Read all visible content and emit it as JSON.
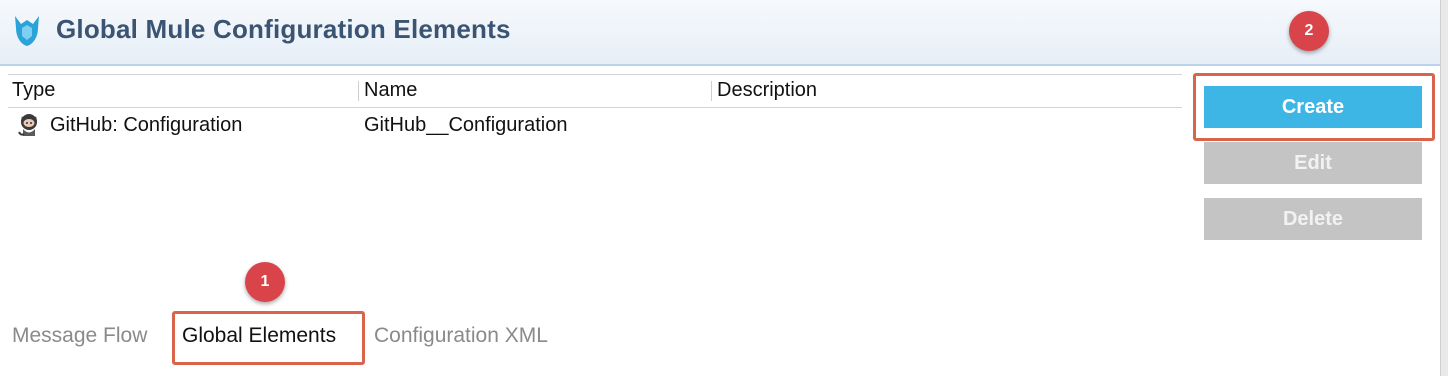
{
  "header": {
    "title": "Global Mule Configuration Elements",
    "logo_icon": "mule-icon"
  },
  "table": {
    "columns": [
      "Type",
      "Name",
      "Description"
    ],
    "rows": [
      {
        "icon": "github-octocat-icon",
        "type": "GitHub: Configuration",
        "name": "GitHub__Configuration",
        "description": ""
      }
    ]
  },
  "buttons": {
    "create": "Create",
    "edit": "Edit",
    "delete": "Delete"
  },
  "tabs": [
    "Message Flow",
    "Global Elements",
    "Configuration XML"
  ],
  "annotations": {
    "badge_1": "1",
    "badge_2": "2"
  },
  "colors": {
    "accent": "#3db6e6",
    "disabled": "#c4c4c4",
    "highlight": "#d9644a",
    "badge": "#d9434a"
  }
}
